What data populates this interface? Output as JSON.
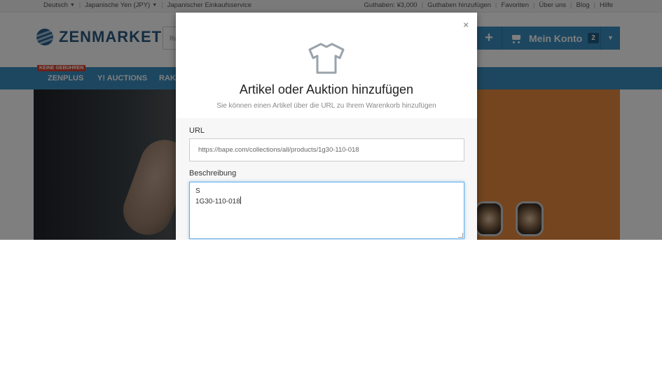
{
  "topbar": {
    "language": "Deutsch",
    "currency": "Japanische Yen (JPY)",
    "service": "Japanischer Einkaufsservice",
    "links": [
      "Guthaben: ¥3,000",
      "Guthaben hinzufügen",
      "Favoriten",
      "Über uns",
      "Blog",
      "Hilfe"
    ]
  },
  "header": {
    "logo": "ZENMARKET",
    "search_placeholder": "Ra",
    "plus_label": "+",
    "account_label": "Mein Konto",
    "cart_count": "2"
  },
  "nav": {
    "badge": "KEINE GEBÜHREN",
    "items": [
      "ZENPLUS",
      "Y! AUCTIONS",
      "RAKU"
    ]
  },
  "modal": {
    "close": "×",
    "icon": "tshirt-icon",
    "title": "Artikel oder Auktion hinzufügen",
    "subtitle": "Sie können einen Artikel über die URL zu Ihrem Warenkorb hinzufügen",
    "url_label": "URL",
    "url_value": "https://bape.com/collections/all/products/1g30-110-018",
    "desc_label": "Beschreibung",
    "desc_lines": [
      "S",
      "1G30-110-018"
    ]
  },
  "colors": {
    "brand_blue": "#3a8ec0",
    "logo_blue": "#2b5a83",
    "badge_red": "#d9402a"
  }
}
